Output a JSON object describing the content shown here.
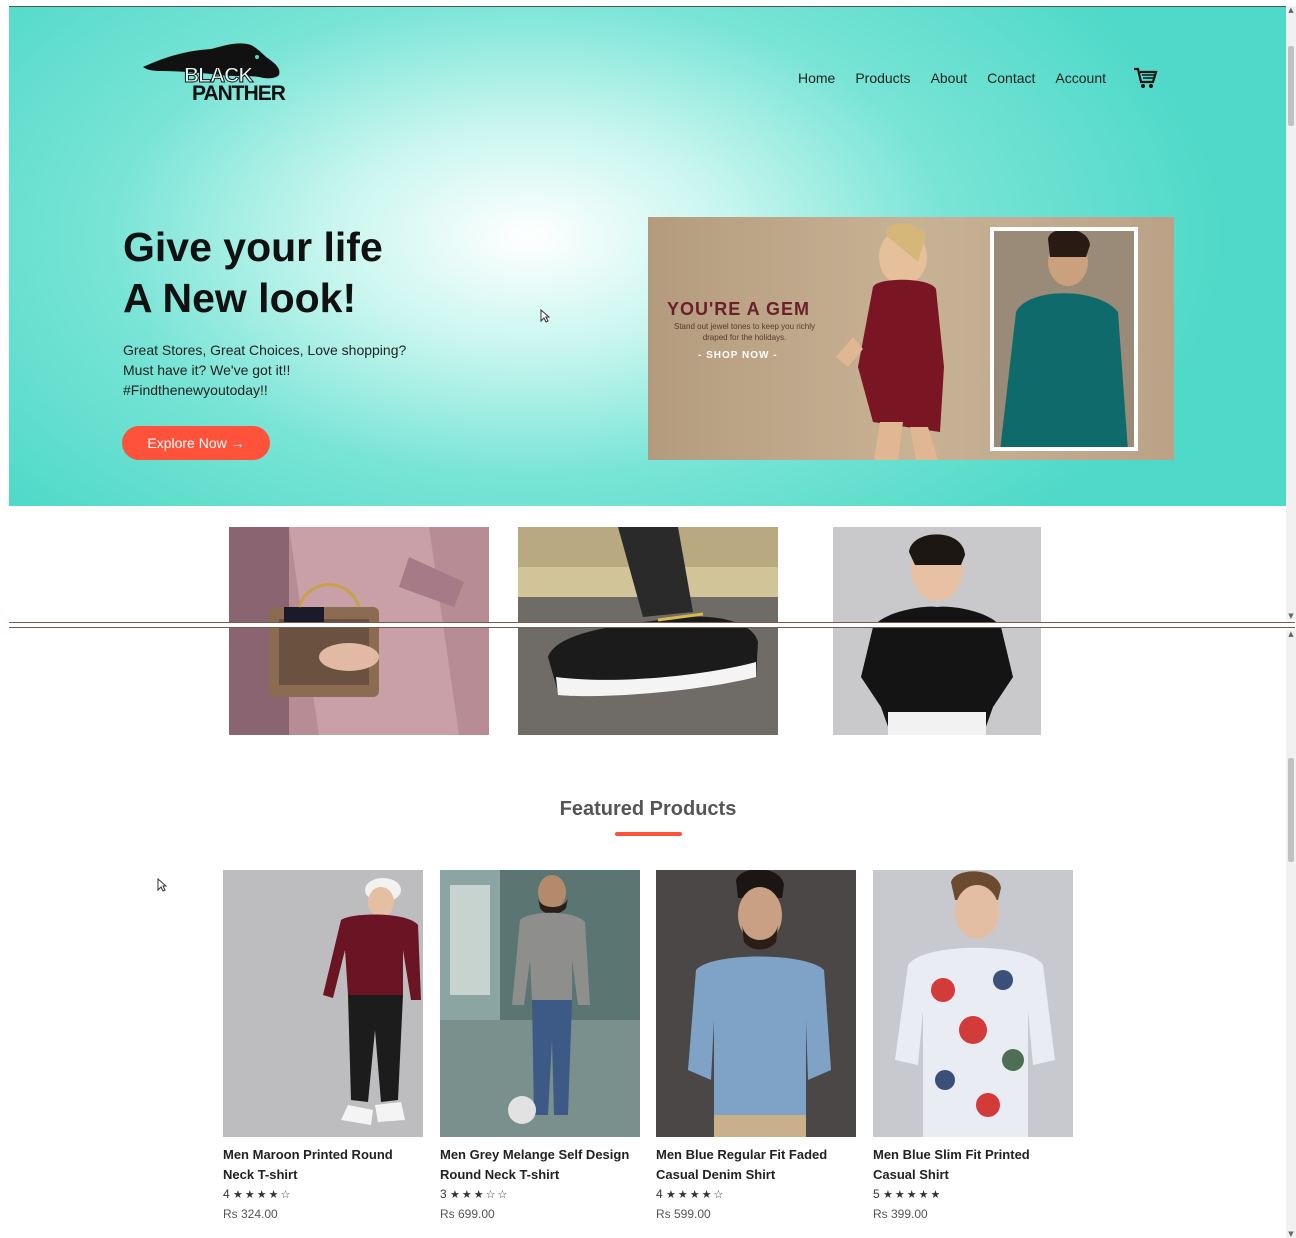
{
  "brand": {
    "logo_line1": "BLACK",
    "logo_line2": "PANTHER"
  },
  "nav": {
    "items": [
      "Home",
      "Products",
      "About",
      "Contact",
      "Account"
    ]
  },
  "hero": {
    "title_line1": "Give your life",
    "title_line2": "A New look!",
    "text_line1": "Great Stores, Great Choices, Love shopping?",
    "text_line2": "Must have it? We've got it!!",
    "text_line3": "#Findthenewyoutoday!!",
    "button_label": "Explore Now →"
  },
  "banner": {
    "title": "YOU'RE A GEM",
    "subtitle": "Stand out jewel tones to keep you richly draped for the holidays.",
    "cta": "- SHOP NOW -"
  },
  "featured": {
    "title": "Featured Products",
    "products": [
      {
        "name": "Men Maroon Printed Round Neck T-shirt",
        "rating": "4",
        "stars": "★★★★☆",
        "price": "Rs 324.00"
      },
      {
        "name": "Men Grey Melange Self Design Round Neck T-shirt",
        "rating": "3",
        "stars": "★★★☆☆",
        "price": "Rs 699.00"
      },
      {
        "name": "Men Blue Regular Fit Faded Casual Denim Shirt",
        "rating": "4",
        "stars": "★★★★☆",
        "price": "Rs 599.00"
      },
      {
        "name": "Men Blue Slim Fit Printed Casual Shirt",
        "rating": "5",
        "stars": "★★★★★",
        "price": "Rs 399.00"
      }
    ]
  },
  "colors": {
    "accent": "#ff523b",
    "hero_bg": "#4fd9c8"
  }
}
